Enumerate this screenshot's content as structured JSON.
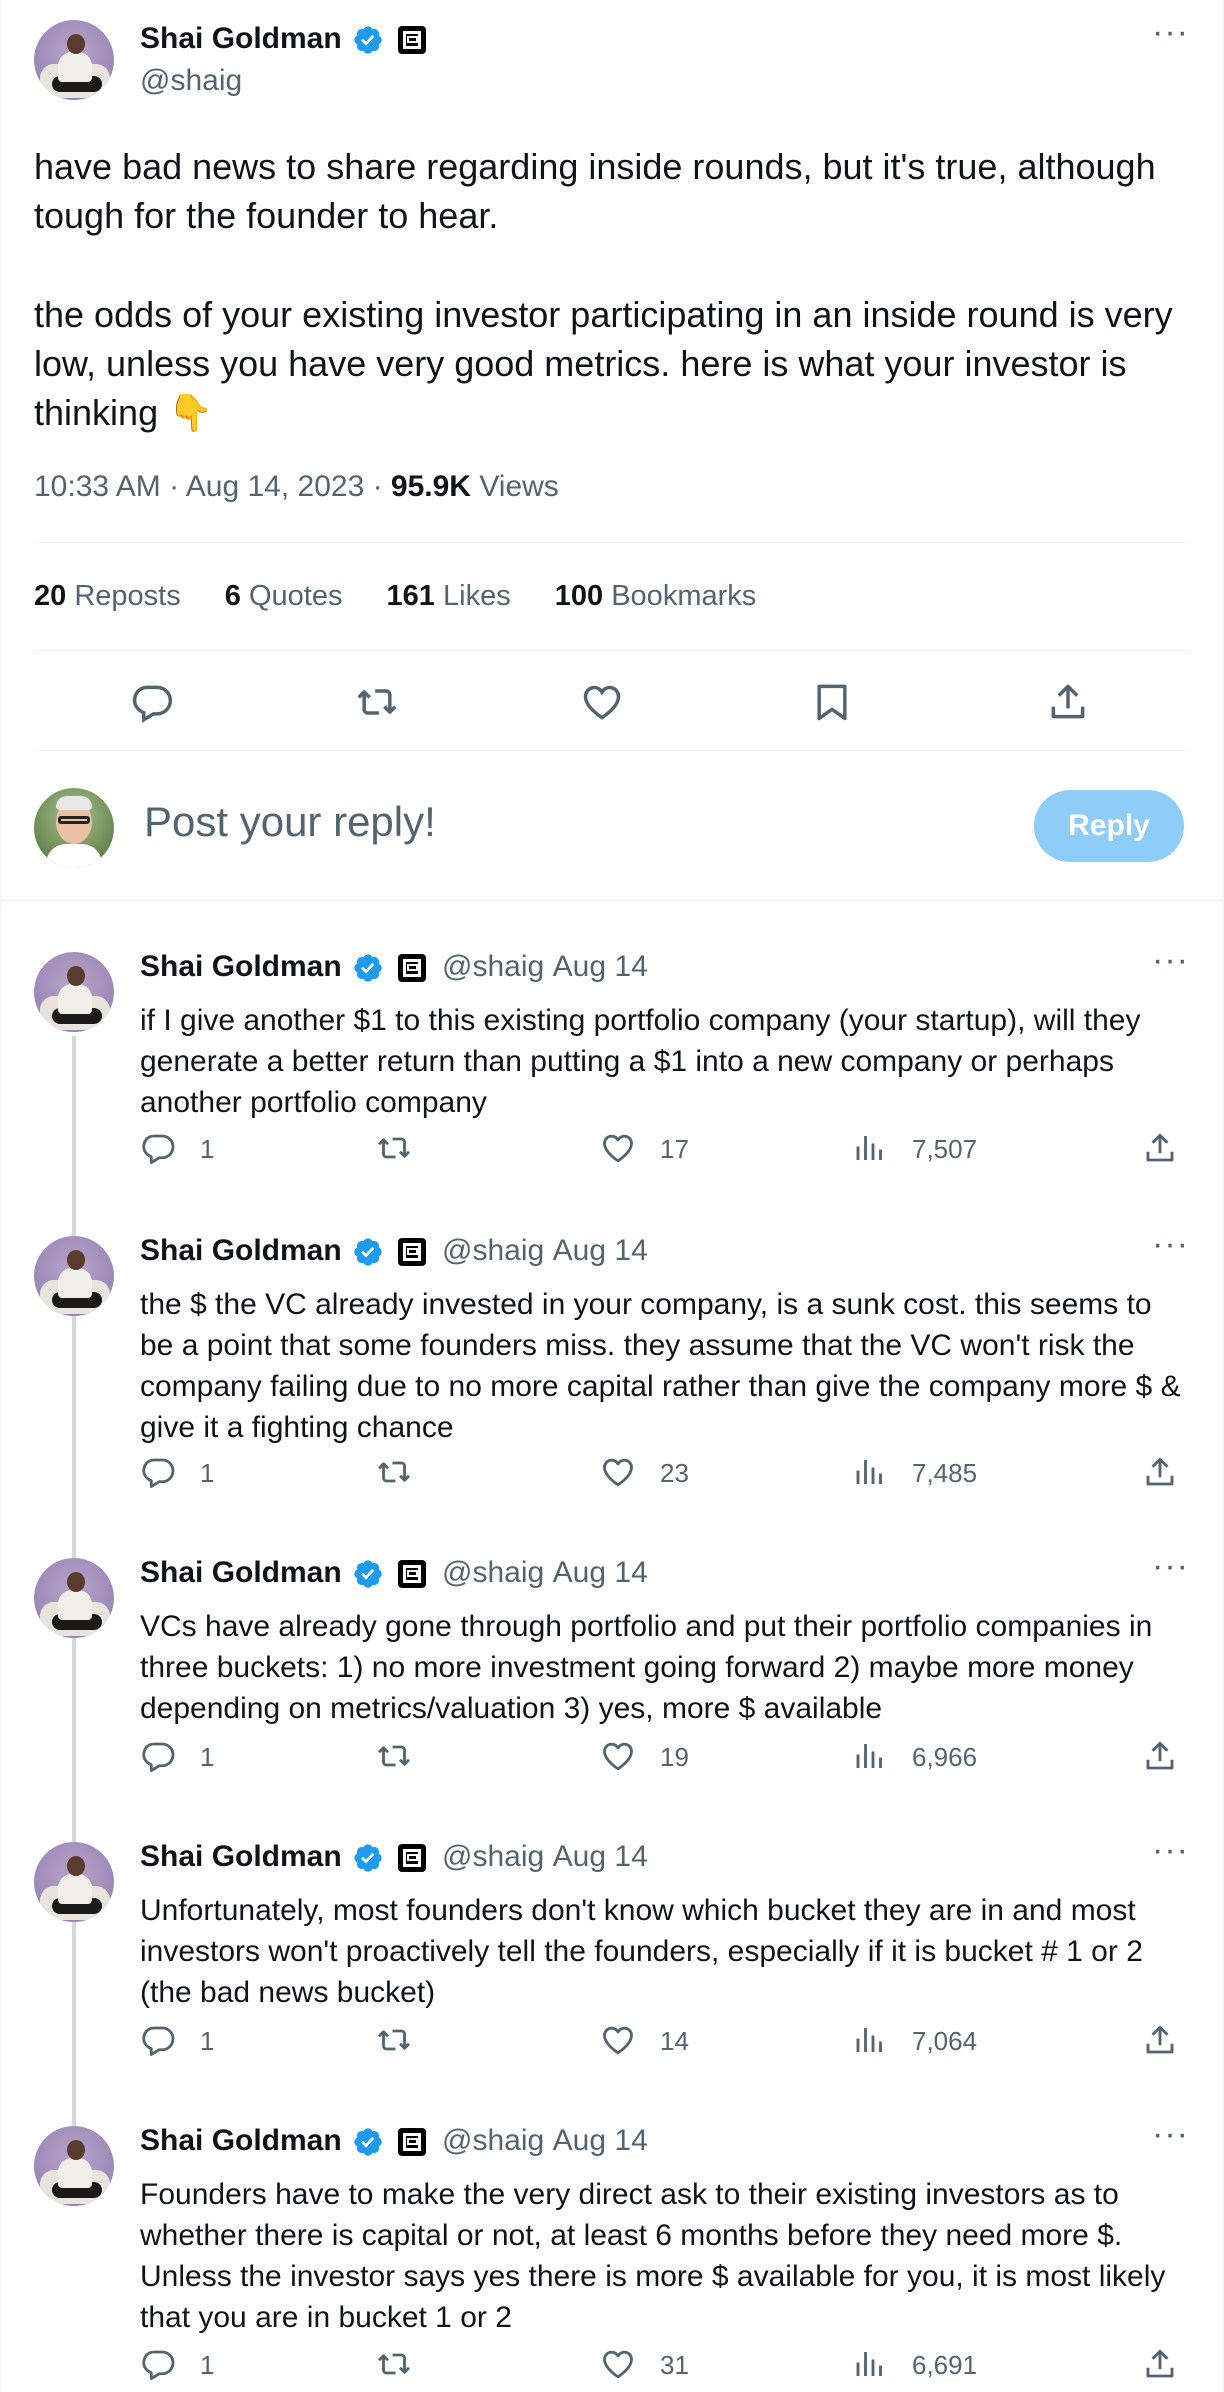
{
  "main_post": {
    "author": "Shai Goldman",
    "handle": "@shaig",
    "paragraph1": "have bad news to share regarding inside rounds, but it's true, although tough for the founder to hear.",
    "paragraph2": "the odds of your existing investor participating in an inside round is very low, unless you have very good metrics.  here is what your investor is thinking 👇",
    "timestamp": "10:33 AM · Aug 14, 2023 · ",
    "views_count": "95.9K",
    "views_label": " Views",
    "stats": {
      "reposts_count": "20",
      "reposts_label": " Reposts",
      "quotes_count": "6",
      "quotes_label": " Quotes",
      "likes_count": "161",
      "likes_label": " Likes",
      "bookmarks_count": "100",
      "bookmarks_label": " Bookmarks"
    }
  },
  "reply_box": {
    "placeholder": "Post your reply!",
    "button_label": "Reply"
  },
  "replies": [
    {
      "author": "Shai Goldman",
      "handle": "@shaig",
      "date": "· Aug 14",
      "text": "if I give another $1 to this existing portfolio company (your startup), will they generate a better return than putting a $1 into a new company or perhaps another portfolio company",
      "replies": "1",
      "likes": "17",
      "views": "7,507"
    },
    {
      "author": "Shai Goldman",
      "handle": "@shaig",
      "date": "· Aug 14",
      "text": "the $ the VC already invested in your company, is a sunk cost.  this seems to be a point that some founders miss.   they assume that the VC won't risk the company failing due to no more capital rather than give the company more $ & give it a fighting chance",
      "replies": "1",
      "likes": "23",
      "views": "7,485"
    },
    {
      "author": "Shai Goldman",
      "handle": "@shaig",
      "date": "· Aug 14",
      "text": "VCs have already gone through portfolio and put their portfolio companies in three buckets: 1) no more investment going forward 2) maybe more money depending on metrics/valuation 3) yes, more $ available",
      "replies": "1",
      "likes": "19",
      "views": "6,966"
    },
    {
      "author": "Shai Goldman",
      "handle": "@shaig",
      "date": "· Aug 14",
      "text": "Unfortunately, most founders don't know which bucket they are in and most investors won't proactively tell the founders, especially if it is bucket # 1 or 2 (the bad news bucket)",
      "replies": "1",
      "likes": "14",
      "views": "7,064"
    },
    {
      "author": "Shai Goldman",
      "handle": "@shaig",
      "date": "· Aug 14",
      "text": "Founders have to make the very direct ask to their existing investors as to whether there is capital or not, at least 6 months before they need more $. Unless the investor says yes there is more $ available for you, it is most likely that you are in bucket 1 or 2",
      "replies": "1",
      "likes": "31",
      "views": "6,691"
    }
  ],
  "icons": {
    "verified": "verified-badge-icon",
    "affiliate": "affiliation-badge-icon",
    "reply": "comment-icon",
    "repost": "repost-icon",
    "like": "heart-icon",
    "bookmark": "bookmark-icon",
    "share": "share-icon",
    "views": "analytics-icon",
    "more": "more-icon"
  },
  "colors": {
    "accent": "#1d9bf0",
    "reply_button_disabled": "#8ecdf8",
    "secondary_text": "#536471",
    "primary_text": "#0f1419"
  }
}
